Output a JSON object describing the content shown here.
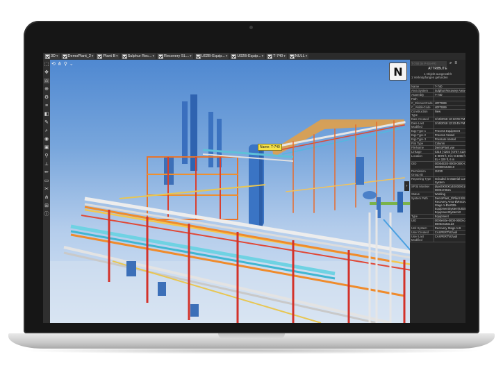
{
  "toolbar": {
    "crumbs": [
      {
        "label": "3D"
      },
      {
        "label": "DemoPlant_2"
      },
      {
        "label": "Plant B"
      },
      {
        "label": "Sulphur Rec..."
      },
      {
        "label": "Recovery SL..."
      },
      {
        "label": "U02B-Equip..."
      },
      {
        "label": "U02B-Equip..."
      },
      {
        "label": "T-740"
      },
      {
        "label": "NULL"
      }
    ]
  },
  "left_tools": [
    "select-tool",
    "pan-tool",
    "home-tool",
    "measure-tool",
    "settings-tool",
    "layers-tool",
    "clip-tool",
    "markup-tool",
    "search-tool",
    "visibility-tool",
    "camera-tool",
    "walk-tool",
    "ruler-tool",
    "pencil-tool",
    "box-tool",
    "scissors-tool",
    "tree-tool",
    "grid-tool",
    "info-tool"
  ],
  "scene": {
    "tag_label": "Name: T-740"
  },
  "logo": {
    "text": "N"
  },
  "panel": {
    "search_placeholder": "T-740 (in P-04-##)",
    "title": "ATTRIBUTE",
    "info_line1": "1 Objekt ausgewählt",
    "info_line2": "1 Verknüpfungen gefunden",
    "rows": [
      {
        "key": "Name",
        "value": "T-740"
      },
      {
        "key": "Area System",
        "value": "Sulphur Recovery Area-B"
      },
      {
        "key": "Assembly",
        "value": "T-740"
      },
      {
        "key": "Path",
        "value": ""
      },
      {
        "key": "C_ElementCode",
        "value": "40F7B89"
      },
      {
        "key": "C_VisibleCode",
        "value": "40F7B89"
      },
      {
        "key": "Construction Type",
        "value": "New"
      },
      {
        "key": "Date Created",
        "value": "1/16/2018 12:12:09 PM"
      },
      {
        "key": "Date Last Modified",
        "value": "1/16/2018 12:23:45 PM"
      },
      {
        "key": "Eqp Type 1",
        "value": "Process Equipment"
      },
      {
        "key": "Eqp Type 2",
        "value": "Process Vessel"
      },
      {
        "key": "Eqp Type 3",
        "value": "Pressure Vessel"
      },
      {
        "key": "Flat Type",
        "value": "Column"
      },
      {
        "key": "FileName",
        "value": "DemoPlant.vue"
      },
      {
        "key": "Linkage",
        "value": "0316 | 0203 | 0707 4126"
      },
      {
        "key": "Location",
        "value": "E 9878 ft, 9 in   N 4055 ft, 8 in   EL+ 320 ft, 6 in"
      },
      {
        "key": "OID",
        "value": "00004E2E-0000-0000-C414-000000154E10"
      },
      {
        "key": "Permission Group ID",
        "value": "11230"
      },
      {
        "key": "Reporting Type",
        "value": "Included in Material Control System"
      },
      {
        "key": "SP3d Moniker",
        "value": "{6px00000014E00000181460} 0000172621"
      },
      {
        "key": "Status",
        "value": "Working"
      },
      {
        "key": "System Path",
        "value": "DemoPlant_2\\Plant B\\Sulphur Recovery Area-B\\Recovery Stage 1-B\\U02B-EquipmentSystem\\U02B-EquipmentSystem\\2"
      },
      {
        "key": "Type",
        "value": "Equipment"
      },
      {
        "key": "UID",
        "value": "0000e92e-0000-0000-c414-5606c0a0a1d3"
      },
      {
        "key": "Unit System",
        "value": "Recovery Stage 1-B"
      },
      {
        "key": "User Created",
        "value": "CAXPERT\\01\\adi"
      },
      {
        "key": "User Last Modified",
        "value": "CAXPERT\\01\\adi"
      }
    ]
  }
}
